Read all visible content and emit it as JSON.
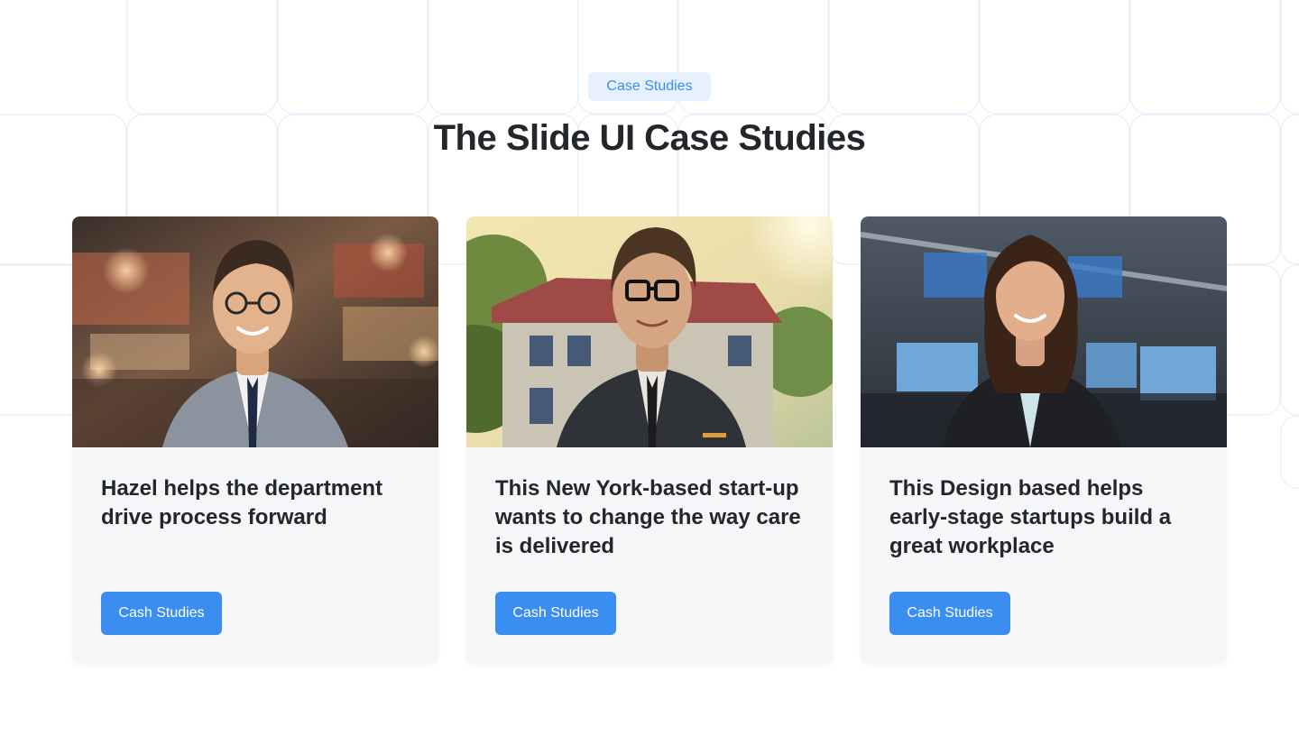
{
  "header": {
    "eyebrow": "Case Studies",
    "title": "The Slide UI Case Studies"
  },
  "cards": [
    {
      "photo": "smiling-man-glasses-grey-suit-photo",
      "text": "Hazel helps the department drive process forward",
      "button_label": "Cash Studies"
    },
    {
      "photo": "smiling-man-glasses-dark-suit-house-photo",
      "text": "This New York-based start-up wants to change the way care is delivered",
      "button_label": "Cash Studies"
    },
    {
      "photo": "smiling-woman-office-monitors-photo",
      "text": "This Design based helps early-stage startups build a great workplace",
      "button_label": "Cash Studies"
    }
  ],
  "colors": {
    "accent": "#3a8ef0",
    "eyebrow_bg": "#e6f1fd",
    "card_bg": "#f5f6f8",
    "grid_line": "#e3f0fb"
  }
}
